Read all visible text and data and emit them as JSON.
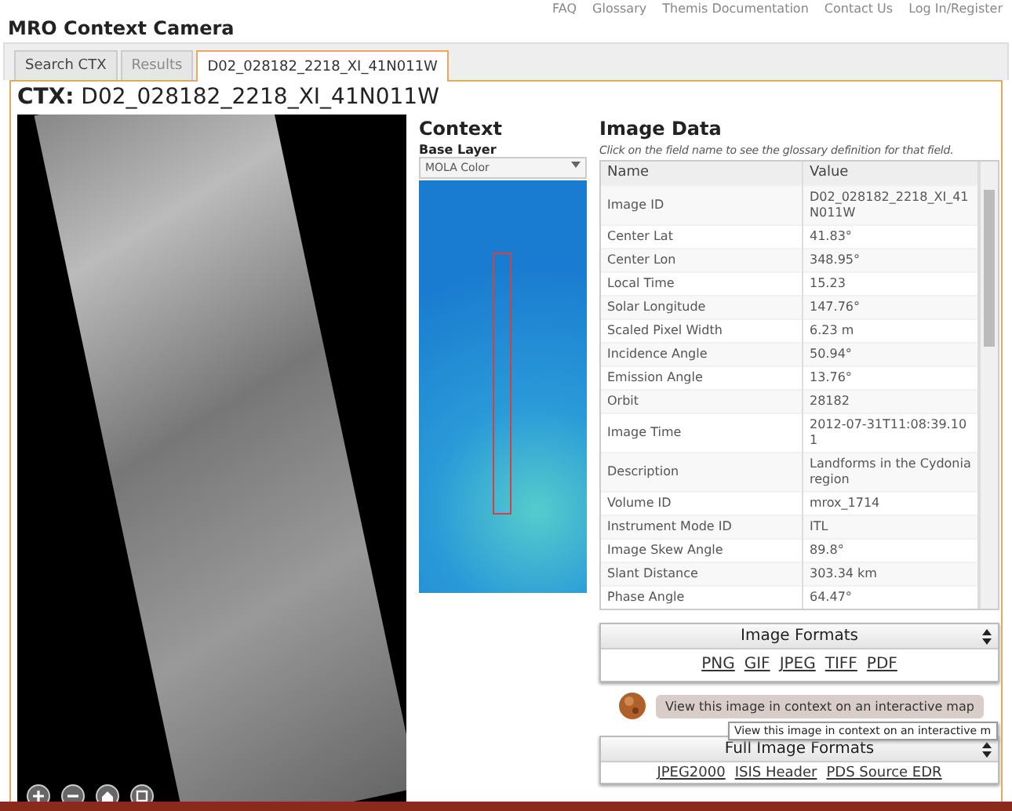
{
  "header": {
    "title": "MRO Context Camera",
    "nav_links": [
      "FAQ",
      "Glossary",
      "Themis Documentation",
      "Contact Us",
      "Log In/Register"
    ]
  },
  "tabs": [
    {
      "label": "Search CTX",
      "selected": false,
      "disabled": false
    },
    {
      "label": "Results",
      "selected": false,
      "disabled": true
    },
    {
      "label": "D02_028182_2218_XI_41N011W",
      "selected": true,
      "disabled": false
    }
  ],
  "product": {
    "prefix": "CTX:",
    "id": "D02_028182_2218_XI_41N011W"
  },
  "context": {
    "title": "Context",
    "base_layer_label": "Base Layer",
    "base_layer": "MOLA Color"
  },
  "image_data": {
    "title": "Image Data",
    "hint": "Click on the field name to see the glossary definition for that field.",
    "columns": [
      "Name",
      "Value"
    ],
    "rows": [
      {
        "name": "Image ID",
        "value": "D02_028182_2218_XI_41N011W"
      },
      {
        "name": "Center Lat",
        "value": "41.83°"
      },
      {
        "name": "Center Lon",
        "value": "348.95°"
      },
      {
        "name": "Local Time",
        "value": "15.23"
      },
      {
        "name": "Solar Longitude",
        "value": "147.76°"
      },
      {
        "name": "Scaled Pixel Width",
        "value": "6.23 m"
      },
      {
        "name": "Incidence Angle",
        "value": "50.94°"
      },
      {
        "name": "Emission Angle",
        "value": "13.76°"
      },
      {
        "name": "Orbit",
        "value": "28182"
      },
      {
        "name": "Image Time",
        "value": "2012-07-31T11:08:39.101"
      },
      {
        "name": "Description",
        "value": "Landforms in the Cydonia region"
      },
      {
        "name": "Volume ID",
        "value": "mrox_1714"
      },
      {
        "name": "Instrument Mode ID",
        "value": "ITL"
      },
      {
        "name": "Image Skew Angle",
        "value": "89.8°"
      },
      {
        "name": "Slant Distance",
        "value": "303.34 km"
      },
      {
        "name": "Phase Angle",
        "value": "64.47°"
      }
    ]
  },
  "image_formats": {
    "title": "Image Formats",
    "links": [
      "PNG",
      "GIF",
      "JPEG",
      "TIFF",
      "PDF"
    ]
  },
  "map_button": {
    "label": "View this image in context on an interactive map",
    "tooltip": "View this image in context on an interactive m"
  },
  "full_image_formats": {
    "title": "Full Image Formats",
    "links": [
      "JPEG2000",
      "ISIS Header",
      "PDS Source EDR"
    ]
  }
}
